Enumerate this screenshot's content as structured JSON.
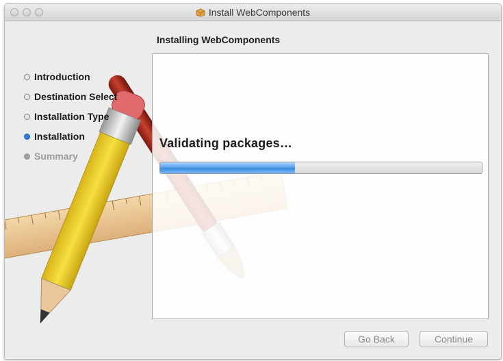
{
  "window": {
    "title": "Install WebComponents",
    "heading": "Installing WebComponents"
  },
  "steps": [
    {
      "label": "Introduction",
      "state": "done"
    },
    {
      "label": "Destination Select",
      "state": "done"
    },
    {
      "label": "Installation Type",
      "state": "done"
    },
    {
      "label": "Installation",
      "state": "current"
    },
    {
      "label": "Summary",
      "state": "future"
    }
  ],
  "main": {
    "status_text": "Validating packages…",
    "progress_fraction": 0.42
  },
  "buttons": {
    "back_label": "Go Back",
    "continue_label": "Continue"
  },
  "colors": {
    "accent": "#2e7cd6",
    "progress_fill": "#5aa4ef"
  },
  "icons": {
    "title_icon": "package-icon",
    "artwork": "pencil-brush-ruler-artwork"
  }
}
